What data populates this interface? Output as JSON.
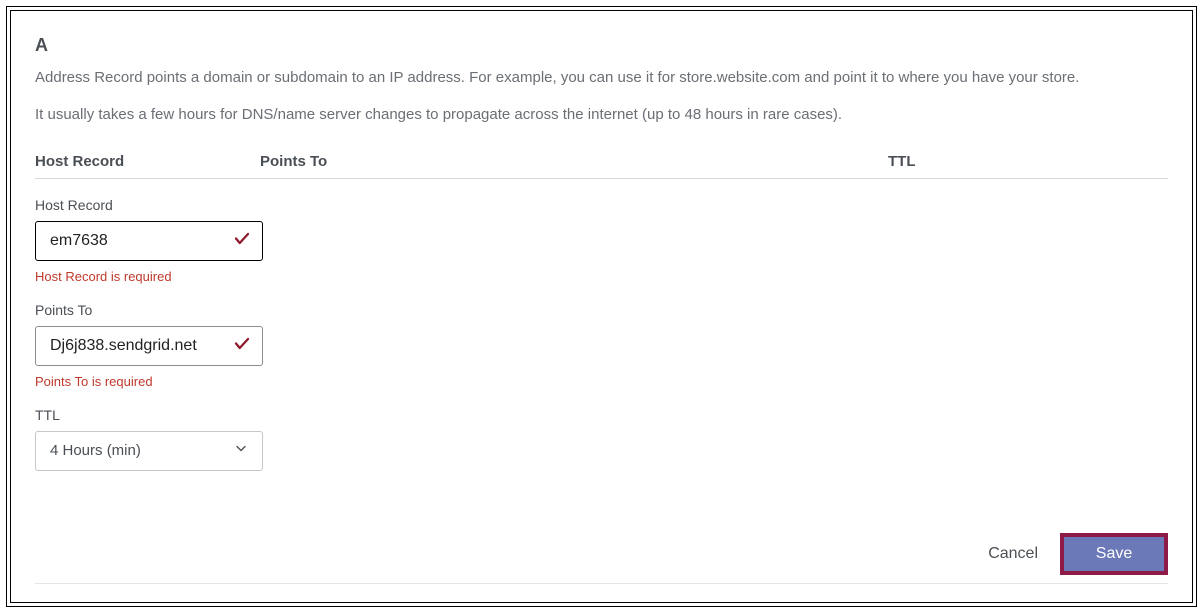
{
  "record_type": "A",
  "description_line1": "Address Record points a domain or subdomain to an IP address. For example, you can use it for store.website.com and point it to where you have your store.",
  "description_line2": "It usually takes a few hours for DNS/name server changes to propagate across the internet (up to 48 hours in rare cases).",
  "columns": {
    "host": "Host Record",
    "points_to": "Points To",
    "ttl": "TTL"
  },
  "fields": {
    "host": {
      "label": "Host Record",
      "value": "em7638",
      "error": "Host Record is required"
    },
    "points_to": {
      "label": "Points To",
      "value": "Dj6j838.sendgrid.net",
      "error": "Points To is required"
    },
    "ttl": {
      "label": "TTL",
      "selected": "4 Hours (min)"
    }
  },
  "buttons": {
    "cancel": "Cancel",
    "save": "Save"
  },
  "colors": {
    "error": "#c0392b",
    "save_bg": "#6c79b8",
    "highlight_border": "#8e1a47"
  }
}
